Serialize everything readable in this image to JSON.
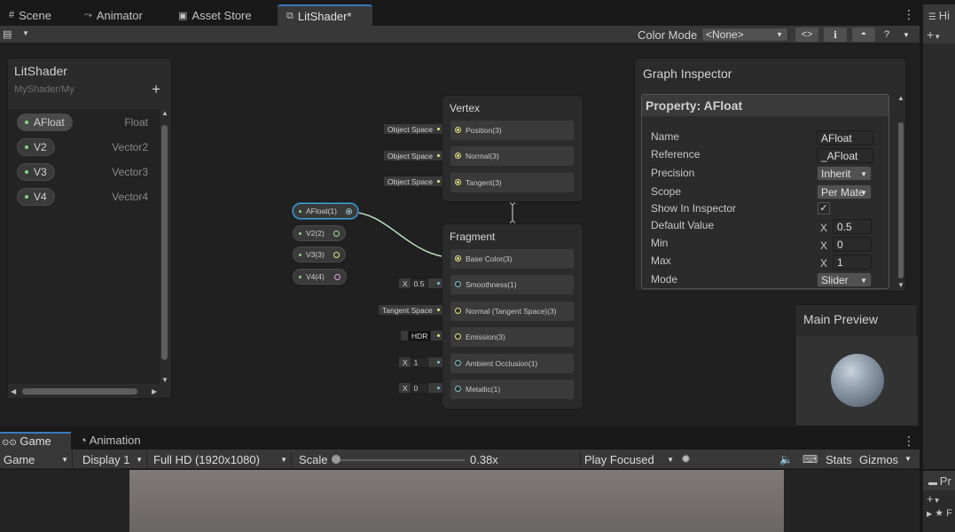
{
  "tabs": [
    {
      "label": "Scene",
      "icon": "grid-icon"
    },
    {
      "label": "Animator",
      "icon": "animator-icon"
    },
    {
      "label": "Asset Store",
      "icon": "bag-icon"
    },
    {
      "label": "LitShader*",
      "icon": "shadergraph-icon",
      "active": true
    }
  ],
  "right_dock": {
    "tab_fragment": "Hi",
    "bottom_fragment": "Pr",
    "bottom_letter": "F"
  },
  "toolbar": {
    "color_mode_label": "Color Mode",
    "color_mode_value": "<None>",
    "code_icon": "<>"
  },
  "blackboard": {
    "title": "LitShader",
    "subtitle": "MyShader/My",
    "add": "+",
    "properties": [
      {
        "name": "AFloat",
        "type": "Float",
        "selected": true
      },
      {
        "name": "V2",
        "type": "Vector2"
      },
      {
        "name": "V3",
        "type": "Vector3"
      },
      {
        "name": "V4",
        "type": "Vector4"
      }
    ]
  },
  "graph": {
    "vertex": {
      "title": "Vertex",
      "slots": [
        {
          "label": "Position(3)",
          "input": "Object Space"
        },
        {
          "label": "Normal(3)",
          "input": "Object Space"
        },
        {
          "label": "Tangent(3)",
          "input": "Object Space"
        }
      ]
    },
    "fragment": {
      "title": "Fragment",
      "slots": [
        {
          "label": "Base Color(3)"
        },
        {
          "label": "Smoothness(1)",
          "input_prefix": "X",
          "input_value": "0.5"
        },
        {
          "label": "Normal (Tangent Space)(3)",
          "input": "Tangent Space"
        },
        {
          "label": "Emission(3)",
          "input": "HDR"
        },
        {
          "label": "Ambient Occlusion(1)",
          "input_prefix": "X",
          "input_value": "1"
        },
        {
          "label": "Metallic(1)",
          "input_prefix": "X",
          "input_value": "0"
        }
      ]
    },
    "property_nodes": [
      "AFloat(1)",
      "V2(2)",
      "V3(3)",
      "V4(4)"
    ]
  },
  "inspector": {
    "title": "Graph Inspector",
    "header": "Property: AFloat",
    "rows": {
      "name_label": "Name",
      "name_value": "AFloat",
      "reference_label": "Reference",
      "reference_value": "_AFloat",
      "precision_label": "Precision",
      "precision_value": "Inherit",
      "scope_label": "Scope",
      "scope_value": "Per Mate",
      "show_label": "Show In Inspector",
      "show_checked": "✓",
      "default_label": "Default Value",
      "default_value": "0.5",
      "min_label": "Min",
      "min_value": "0",
      "max_label": "Max",
      "max_value": "1",
      "mode_label": "Mode",
      "mode_value": "Slider",
      "x": "X"
    }
  },
  "preview": {
    "title": "Main Preview"
  },
  "game_tabs": [
    {
      "label": "Game",
      "icon": "gamepad-icon",
      "active": true
    },
    {
      "label": "Animation",
      "icon": "clock-icon"
    }
  ],
  "game_toolbar": {
    "view": "Game",
    "display": "Display 1",
    "resolution": "Full HD (1920x1080)",
    "scale_label": "Scale",
    "scale_value": "0.38x",
    "play_mode": "Play Focused",
    "stats": "Stats",
    "gizmos": "Gizmos"
  }
}
